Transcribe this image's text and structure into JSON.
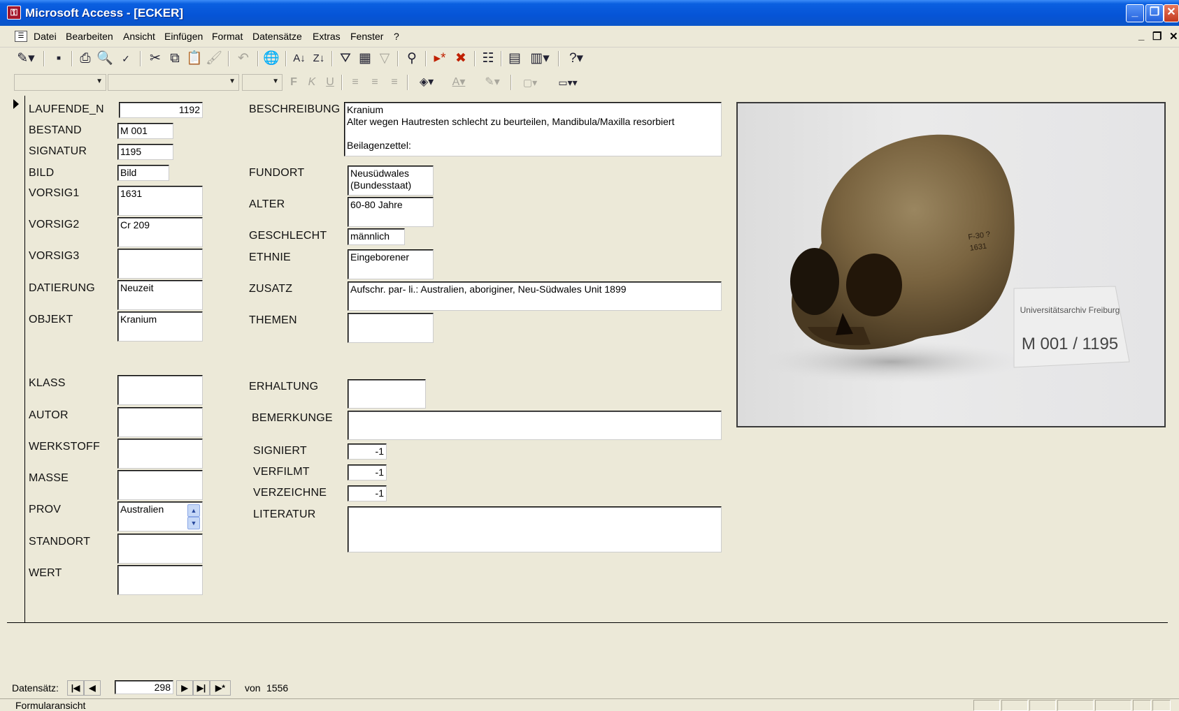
{
  "window": {
    "app_title": "Microsoft Access - [ECKER]"
  },
  "menu": {
    "items": [
      "Datei",
      "Bearbeiten",
      "Ansicht",
      "Einfügen",
      "Format",
      "Datensätze",
      "Extras",
      "Fenster",
      "?"
    ]
  },
  "form": {
    "laufende_n": {
      "label": "LAUFENDE_N",
      "value": "1192"
    },
    "bestand": {
      "label": "BESTAND",
      "value": "M 001"
    },
    "signatur": {
      "label": "SIGNATUR",
      "value": "1195"
    },
    "bild": {
      "label": "BILD",
      "value": "Bild"
    },
    "vorsig1": {
      "label": "VORSIG1",
      "value": "1631"
    },
    "vorsig2": {
      "label": "VORSIG2",
      "value": "Cr 209"
    },
    "vorsig3": {
      "label": "VORSIG3",
      "value": ""
    },
    "datierung": {
      "label": "DATIERUNG",
      "value": "Neuzeit"
    },
    "objekt": {
      "label": "OBJEKT",
      "value": "Kranium"
    },
    "klass": {
      "label": "KLASS",
      "value": ""
    },
    "autor": {
      "label": "AUTOR",
      "value": ""
    },
    "werkstoff": {
      "label": "WERKSTOFF",
      "value": ""
    },
    "masse": {
      "label": "MASSE",
      "value": ""
    },
    "prov": {
      "label": "PROV",
      "value": "Australien"
    },
    "standort": {
      "label": "STANDORT",
      "value": ""
    },
    "wert": {
      "label": "WERT",
      "value": ""
    },
    "beschreibung": {
      "label": "BESCHREIBUNG",
      "value": "Kranium\nAlter wegen Hautresten schlecht zu beurteilen, Mandibula/Maxilla resorbiert\n\nBeilagenzettel:"
    },
    "fundort": {
      "label": "FUNDORT",
      "value": "Neusüdwales\n(Bundesstaat)"
    },
    "alter": {
      "label": "ALTER",
      "value": "60-80 Jahre"
    },
    "geschlecht": {
      "label": "GESCHLECHT",
      "value": "männlich"
    },
    "ethnie": {
      "label": "ETHNIE",
      "value": "Eingeborener"
    },
    "zusatz": {
      "label": "ZUSATZ",
      "value": "Aufschr. par- li.: Australien, aboriginer, Neu-Südwales Unit 1899"
    },
    "themen": {
      "label": "THEMEN",
      "value": ""
    },
    "erhaltung": {
      "label": "ERHALTUNG",
      "value": ""
    },
    "bemerkunge": {
      "label": "BEMERKUNGE",
      "value": ""
    },
    "signiert": {
      "label": "SIGNIERT",
      "value": "-1"
    },
    "verfilmt": {
      "label": "VERFILMT",
      "value": "-1"
    },
    "verzeichne": {
      "label": "VERZEICHNE",
      "value": "-1"
    },
    "literatur": {
      "label": "LITERATUR",
      "value": ""
    }
  },
  "photo": {
    "card_line1": "Universitätsarchiv Freiburg",
    "card_line2": "M 001 / 1195",
    "skull_inscription": "F-30 ?\n1631"
  },
  "navigation": {
    "label": "Datensätz:",
    "current": "298",
    "of_label": "von",
    "total": "1556"
  },
  "status": {
    "text": "Formularansicht"
  }
}
